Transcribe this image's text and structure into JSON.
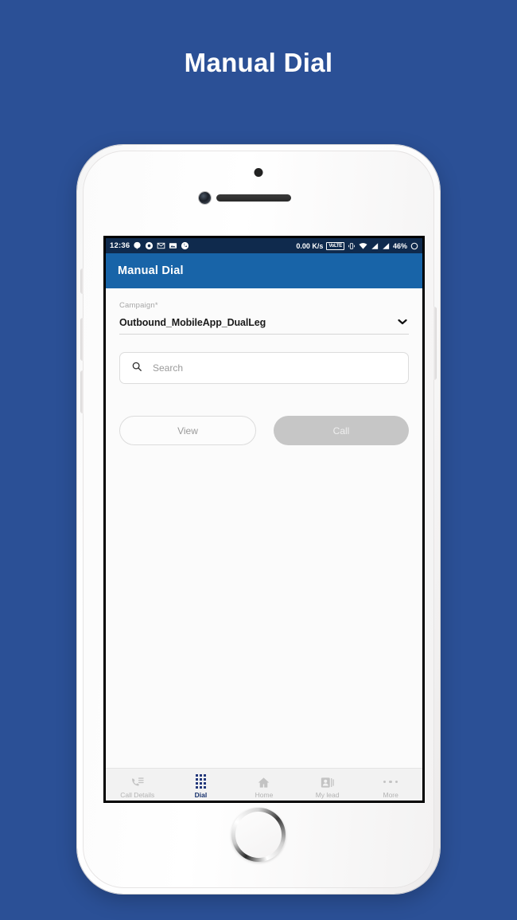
{
  "page": {
    "heading": "Manual Dial",
    "background_color": "#2b5096"
  },
  "status_bar": {
    "time": "12:36",
    "left_icons": [
      "hangouts-icon",
      "circle-app-icon",
      "gmail-icon",
      "photos-icon",
      "phone-icon"
    ],
    "network_speed": "0.00 K/s",
    "volte_label": "VoLTE",
    "right_icons": [
      "vibrate-icon",
      "wifi-icon",
      "signal-1-icon",
      "signal-2-icon"
    ],
    "battery_percent": "46%"
  },
  "app_bar": {
    "title": "Manual Dial",
    "color": "#1864a8"
  },
  "form": {
    "campaign_label": "Campaign*",
    "campaign_value": "Outbound_MobileApp_DualLeg",
    "search_placeholder": "Search",
    "search_value": ""
  },
  "actions": {
    "view_label": "View",
    "call_label": "Call"
  },
  "tab_bar": {
    "items": [
      {
        "label": "Call Details",
        "icon": "call-details-icon",
        "active": false
      },
      {
        "label": "Dial",
        "icon": "dialpad-icon",
        "active": true
      },
      {
        "label": "Home",
        "icon": "home-icon",
        "active": false
      },
      {
        "label": "My lead",
        "icon": "contact-card-icon",
        "active": false
      },
      {
        "label": "More",
        "icon": "more-dots-icon",
        "active": false
      }
    ],
    "active_color": "#16306b",
    "inactive_color": "#b3b3b3"
  },
  "system_nav": {
    "back": "back-icon",
    "home": "home-circle-icon",
    "recents": "recents-square-icon"
  }
}
